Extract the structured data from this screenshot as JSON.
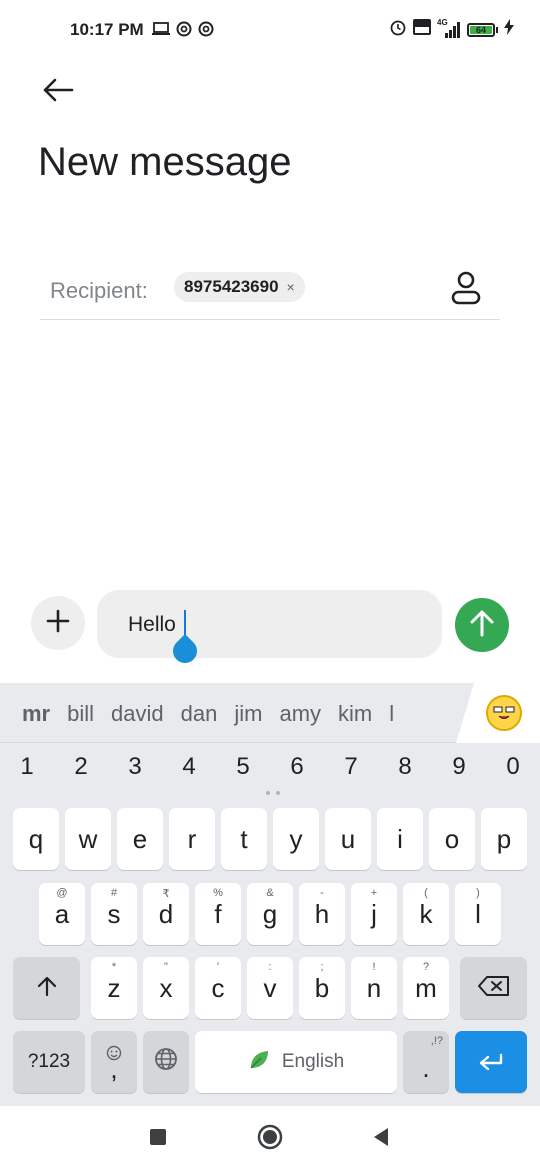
{
  "status_bar": {
    "time": "10:17 PM",
    "battery_level": "64",
    "network": "4G",
    "icons_left": [
      "laptop-icon",
      "at-icon",
      "at-icon"
    ],
    "icons_right": [
      "alarm-icon",
      "volte-icon",
      "signal-icon",
      "battery-icon",
      "charging-icon"
    ]
  },
  "header": {
    "back_icon": "arrow-left-icon",
    "title": "New message"
  },
  "recipient": {
    "label": "Recipient:",
    "chip_number": "8975423690",
    "chip_remove": "×",
    "contact_icon": "person-icon"
  },
  "compose": {
    "add_icon": "plus-icon",
    "text": "Hello",
    "send_icon": "arrow-up-icon",
    "send_color": "#34a853"
  },
  "keyboard": {
    "suggestions": [
      "mr",
      "bill",
      "david",
      "dan",
      "jim",
      "amy",
      "kim",
      "l"
    ],
    "numbers": [
      "1",
      "2",
      "3",
      "4",
      "5",
      "6",
      "7",
      "8",
      "9",
      "0"
    ],
    "row1": [
      {
        "key": "q"
      },
      {
        "key": "w"
      },
      {
        "key": "e"
      },
      {
        "key": "r"
      },
      {
        "key": "t"
      },
      {
        "key": "y"
      },
      {
        "key": "u"
      },
      {
        "key": "i"
      },
      {
        "key": "o"
      },
      {
        "key": "p"
      }
    ],
    "row2": [
      {
        "key": "a",
        "hint": "@"
      },
      {
        "key": "s",
        "hint": "#"
      },
      {
        "key": "d",
        "hint": "₹"
      },
      {
        "key": "f",
        "hint": "%"
      },
      {
        "key": "g",
        "hint": "&"
      },
      {
        "key": "h",
        "hint": "-"
      },
      {
        "key": "j",
        "hint": "+"
      },
      {
        "key": "k",
        "hint": "("
      },
      {
        "key": "l",
        "hint": ")"
      }
    ],
    "row3": [
      {
        "key": "z",
        "hint": "*"
      },
      {
        "key": "x",
        "hint": "\""
      },
      {
        "key": "c",
        "hint": "'"
      },
      {
        "key": "v",
        "hint": ":"
      },
      {
        "key": "b",
        "hint": ";"
      },
      {
        "key": "n",
        "hint": "!"
      },
      {
        "key": "m",
        "hint": "?"
      }
    ],
    "symbols_label": "?123",
    "comma_label": ",",
    "space_label": "English",
    "period_label": ".",
    "period_hint": ",!?",
    "accent_color": "#1a8fe3"
  },
  "nav_bar": {
    "recents_icon": "square-icon",
    "home_icon": "circle-icon",
    "back_icon": "triangle-back-icon"
  }
}
